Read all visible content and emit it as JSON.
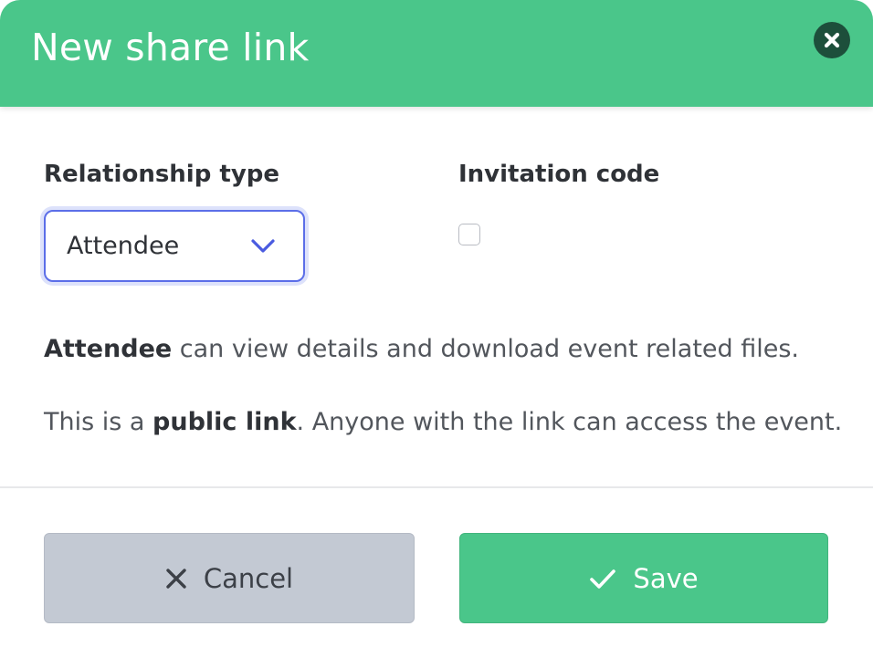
{
  "dialog": {
    "title": "New share link"
  },
  "form": {
    "relationship_label": "Relationship type",
    "relationship_value": "Attendee",
    "invitation_label": "Invitation code",
    "invitation_checked": false
  },
  "description": {
    "line1_bold": "Attendee",
    "line1_rest": " can view details and download event related files.",
    "line2_start": "This is a ",
    "line2_bold": "public link",
    "line2_end": ". Anyone with the link can access the event."
  },
  "footer": {
    "cancel_label": "Cancel",
    "save_label": "Save"
  },
  "icons": {
    "close": "close-icon",
    "chevron": "chevron-down-icon",
    "cancel": "x-icon",
    "save": "check-icon"
  },
  "colors": {
    "accent_green": "#4ac68a",
    "close_bg": "#1d4f3b",
    "select_border": "#5b6ee8",
    "cancel_bg": "#c3c9d3"
  }
}
